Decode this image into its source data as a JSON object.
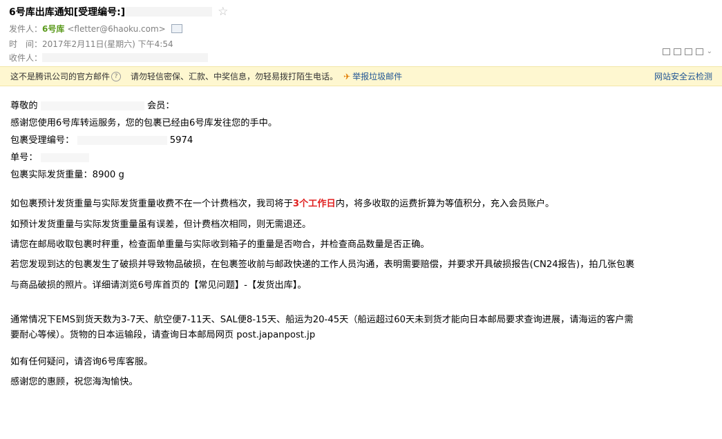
{
  "mail": {
    "subject": "6号库出库通知[受理编号:]",
    "star_icon": "star-icon",
    "from_label": "发件人：",
    "from_name": "6号库",
    "from_email": "<fletter@6haoku.com>",
    "time_label": "时　间：",
    "time_value": "2017年2月11日(星期六) 下午4:54",
    "to_label": "收件人："
  },
  "warning": {
    "text": "这不是腾讯公司的官方邮件",
    "text2": "请勿轻信密保、汇款、中奖信息，勿轻易拨打陌生电话。",
    "report_link": "举报垃圾邮件",
    "safety_link": "网站安全云检测"
  },
  "body": {
    "greeting_a": "尊敬的",
    "greeting_b": "会员：",
    "thanks": "感谢您使用6号库转运服务，您的包裹已经由6号库发往您的手中。",
    "pkg_no_label": "包裹受理编号：",
    "pkg_no_suffix": "5974",
    "tracking_label": "单号：",
    "weight": "包裹实际发货重量：8900 g",
    "p1a": "如包裹预计发货重量与实际发货重量收费不在一个计费档次，我司将于",
    "p1_highlight": "3个工作日",
    "p1b": "内，将多收取的运费折算为等值积分，充入会员账户。",
    "p2": "如预计发货重量与实际发货重量虽有误差，但计费档次相同，则无需退还。",
    "p3": "请您在邮局收取包裹时秤重，检查面单重量与实际收到箱子的重量是否吻合，并检查商品数量是否正确。",
    "p4_line1": "若您发现到达的包裹发生了破损并导致物品破损，在包裹签收前与邮政快递的工作人员沟通，表明需要赔偿，并要求开具破损报告(CN24报告)，拍几张包裹",
    "p4_line2": "与商品破损的照片。详细请浏览6号库首页的【常见问题】-【发货出库】。",
    "p5_line1": "通常情况下EMS到货天数为3-7天、航空便7-11天、SAL便8-15天、船运为20-45天（船运超过60天未到货才能向日本邮局要求查询进展，请海运的客户需",
    "p5_line2": "要耐心等候）。货物的日本运输段，请查询日本邮局网页 post.japanpost.jp",
    "p6": "如有任何疑问，请咨询6号库客服。",
    "p7": "感谢您的惠顾，祝您海淘愉快。"
  }
}
